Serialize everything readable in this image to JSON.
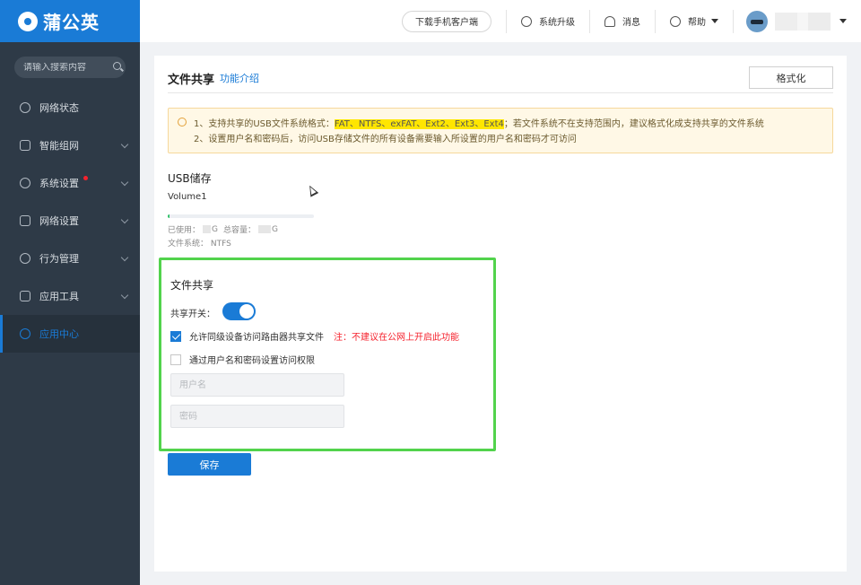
{
  "brand": {
    "name": "蒲公英",
    "color": "#1a7bd6",
    "logo_icon": "dandelion-logo"
  },
  "sidebar": {
    "search_placeholder": "请输入搜索内容",
    "items": [
      {
        "label": "网络状态",
        "icon": "network-status-icon",
        "has_submenu": false
      },
      {
        "label": "智能组网",
        "icon": "smart-network-icon",
        "has_submenu": true
      },
      {
        "label": "系统设置",
        "icon": "system-settings-icon",
        "has_submenu": true,
        "badge_dot": true
      },
      {
        "label": "网络设置",
        "icon": "network-settings-icon",
        "has_submenu": true
      },
      {
        "label": "行为管理",
        "icon": "behavior-management-icon",
        "has_submenu": true
      },
      {
        "label": "应用工具",
        "icon": "app-tools-icon",
        "has_submenu": true
      },
      {
        "label": "应用中心",
        "icon": "app-center-icon",
        "has_submenu": false,
        "active": true
      }
    ]
  },
  "topbar": {
    "download_label": "下载手机客户端",
    "upgrade_label": "系统升级",
    "messages_label": "消息",
    "help_label": "帮助"
  },
  "page": {
    "title": "文件共享",
    "intro_link": "功能介绍",
    "format_button": "格式化",
    "notice": {
      "line1_prefix": "1、支持共享的USB文件系统格式：",
      "line1_formats": "FAT、NTFS、exFAT、Ext2、Ext3、Ext4",
      "line1_suffix": "；若文件系统不在支持范围内，建议格式化成支持共享的文件系统",
      "line2": "2、设置用户名和密码后，访问USB存储文件的所有设备需要输入所设置的用户名和密码才可访问"
    },
    "usb": {
      "section_title": "USB储存",
      "volume_name": "Volume1",
      "usage_fraction": 0.01,
      "used_label": "已使用：",
      "total_label": "总容量：",
      "unit": "G",
      "fs_label": "文件系统：",
      "fs_value": "NTFS"
    },
    "share": {
      "section_title": "文件共享",
      "switch_label": "共享开关：",
      "switch_on": true,
      "allow_lan_label": "允许同级设备访问路由器共享文件",
      "allow_lan_checked": true,
      "allow_lan_warning": "注：不建议在公网上开启此功能",
      "auth_label": "通过用户名和密码设置访问权限",
      "auth_checked": false,
      "username_placeholder": "用户名",
      "password_placeholder": "密码"
    },
    "save_button": "保存"
  }
}
